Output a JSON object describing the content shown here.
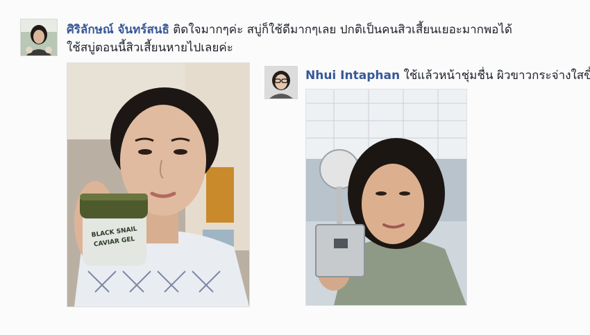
{
  "comments": [
    {
      "author": "ศิริลักษณ์ จันทร์สนธิ",
      "text_line1": "ติดใจมากๆค่ะ สบู่ก็ใช้ดีมากๆเลย ปกติเป็นคนสิวเสี้ยนเยอะมากพอได้",
      "text_line2": "ใช้สบู่ตอนนี้สิวเสี้ยนหายไปเลยค่ะ",
      "photo_label": "BLACK SNAIL CAVIAR GEL"
    },
    {
      "author": "Nhui Intaphan",
      "text": "ใช้แล้วหน้าชุ่มชื่น ผิวขาวกระจ่างใสขึ้น"
    }
  ]
}
